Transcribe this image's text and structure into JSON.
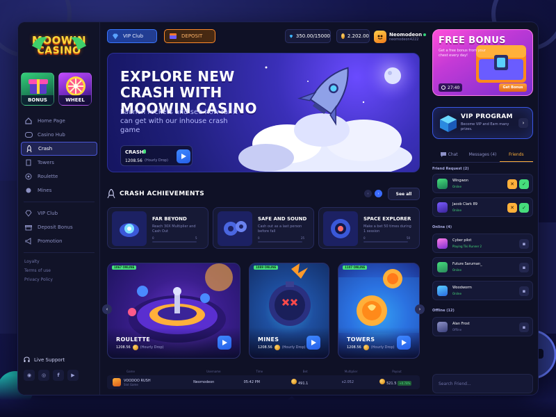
{
  "brand": {
    "line1": "MOOWIN",
    "line2": "CASINO"
  },
  "quick_tiles": [
    {
      "label": "BONUS"
    },
    {
      "label": "WHEEL"
    }
  ],
  "nav": {
    "main": [
      {
        "label": "Home Page",
        "icon": "home-icon"
      },
      {
        "label": "Casino Hub",
        "icon": "gamepad-icon"
      },
      {
        "label": "Crash",
        "icon": "rocket-icon",
        "active": true
      },
      {
        "label": "Towers",
        "icon": "tower-icon"
      },
      {
        "label": "Roulette",
        "icon": "roulette-icon"
      },
      {
        "label": "Mines",
        "icon": "mine-icon"
      }
    ],
    "secondary": [
      {
        "label": "VIP Club",
        "icon": "diamond-icon"
      },
      {
        "label": "Deposit Bonus",
        "icon": "gift-icon"
      },
      {
        "label": "Promotion",
        "icon": "megaphone-icon"
      }
    ],
    "links": [
      "Loyalty",
      "Terms of use",
      "Privacy Policy"
    ],
    "live_support": "Live Support",
    "socials": [
      "discord-icon",
      "instagram-icon",
      "facebook-icon",
      "youtube-icon"
    ]
  },
  "topbar": {
    "vip_label": "VIP Club",
    "deposit_label": "DEPOSIT",
    "balance": "350.00/15000",
    "gold": "2.202.00",
    "user": {
      "name": "Neomodeon",
      "handle": "neomodeon4222"
    }
  },
  "hero": {
    "title": "EXPLORE NEW CRASH WITH MOOWIN CASINO",
    "subtitle": "Launch rockets and see how far it can get with our inhouse crash game",
    "game": {
      "name": "CRASH",
      "badge": "",
      "amount": "1208.56",
      "tag": "(Hourly Drop)"
    }
  },
  "achievements": {
    "title": "CRASH ACHIEVEMENTS",
    "see_all": "See all",
    "cards": [
      {
        "name": "FAR BEYOND",
        "desc": "Reach 30X Multiplier and Cash Out",
        "min": "0",
        "max": "5",
        "progress": 0.0
      },
      {
        "name": "SAFE AND SOUND",
        "desc": "Cash out as a last person before fall",
        "min": "0",
        "max": "25",
        "progress": 0.0
      },
      {
        "name": "SPACE EXPLORER",
        "desc": "Make a bet 50 times during 1 session",
        "min": "0",
        "max": "50",
        "progress": 0.0
      }
    ]
  },
  "games": [
    {
      "name": "ROULETTE",
      "online": "1067 ONLINE",
      "amount": "1208.56",
      "tag": "(Hourly Drop)"
    },
    {
      "name": "MINES",
      "online": "1089 ONLINE",
      "amount": "1208.56",
      "tag": "(Hourly Drop)"
    },
    {
      "name": "TOWERS",
      "online": "1107 ONLINE",
      "amount": "1208.56",
      "tag": "(Hourly Drop)"
    }
  ],
  "bets_table": {
    "headers": [
      "Game",
      "Username",
      "Time",
      "Bet",
      "Multiplier",
      "Payout"
    ],
    "rows": [
      {
        "game": "VOODOO RUSH",
        "game_sub": "Slot Game",
        "username": "Neomodeon",
        "time": "05:42 PM",
        "bet": "491.1",
        "multiplier": "x2.052",
        "payout": "521.5",
        "payout_delta": "+0.78%"
      }
    ]
  },
  "free_bonus": {
    "title": "FREE BONUS",
    "subtitle": "Get a free bonus from your chest every day!",
    "timer": "27:40",
    "button": "Get Bonus"
  },
  "vip_program": {
    "title": "VIP PROGRAM",
    "subtitle": "Become VIP and Earn many prizes."
  },
  "social_tabs": [
    {
      "label": "Chat"
    },
    {
      "label": "Messages (4)"
    },
    {
      "label": "Friends",
      "active": true
    }
  ],
  "friend_requests": {
    "label": "Friend Request (2)",
    "items": [
      {
        "name": "Wingwon",
        "status": "Online"
      },
      {
        "name": "Jacob Clark 89",
        "status": "Online"
      }
    ]
  },
  "online": {
    "label": "Online (4)",
    "items": [
      {
        "name": "Cyber pilot",
        "status": "Playing Tiki Runner 2"
      },
      {
        "name": "Future Saruman_",
        "status": "Online"
      },
      {
        "name": "Woodworm",
        "status": "Online"
      }
    ]
  },
  "offline": {
    "label": "Offline (12)",
    "items": [
      {
        "name": "Alan Frost",
        "status": "Offline"
      }
    ]
  },
  "search_friend_placeholder": "Search Friend..."
}
